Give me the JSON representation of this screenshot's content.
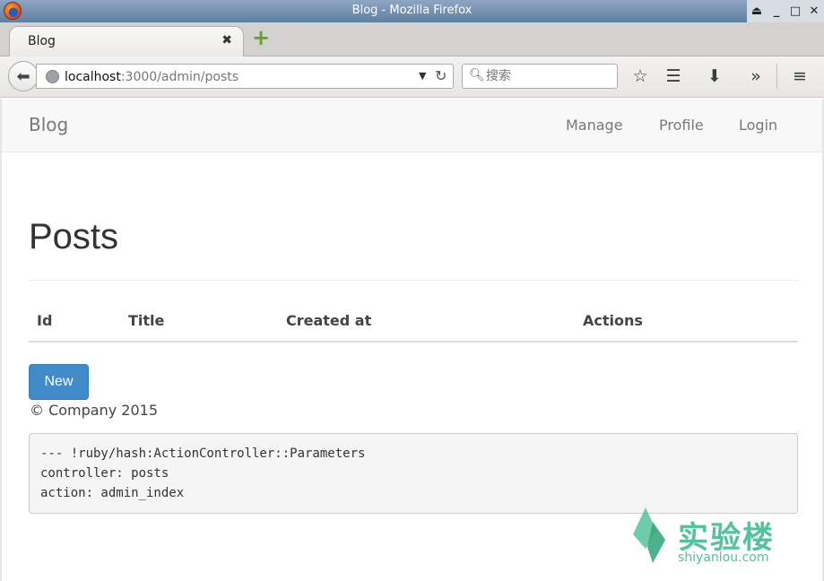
{
  "window": {
    "title": "Blog - Mozilla Firefox",
    "controls": [
      "⏏",
      "_",
      "□",
      "✕"
    ]
  },
  "tabs": [
    {
      "label": "Blog",
      "close": "✖"
    }
  ],
  "newtab_label": "+",
  "navbar": {
    "url_host": "localhost",
    "url_rest": ":3000/admin/posts",
    "search_placeholder": "搜索",
    "icons": [
      "back-icon",
      "globe-icon",
      "dropdown-icon",
      "reload-icon",
      "search-icon",
      "bookmark-star-icon",
      "reading-list-icon",
      "download-icon",
      "overflow-icon",
      "menu-icon"
    ]
  },
  "site": {
    "brand": "Blog",
    "nav": [
      "Manage",
      "Profile",
      "Login"
    ]
  },
  "page": {
    "title": "Posts",
    "columns": [
      "Id",
      "Title",
      "Created at",
      "Actions"
    ],
    "new_button": "New",
    "footer": "© Company 2015",
    "debug_lines": [
      "--- !ruby/hash:ActionController::Parameters",
      "controller: posts",
      "action: admin_index"
    ]
  },
  "watermark": {
    "text": "实验楼",
    "sub": "shiyanlou.com"
  },
  "colors": {
    "primary_button": "#428bca",
    "watermark": "#53c39a"
  }
}
